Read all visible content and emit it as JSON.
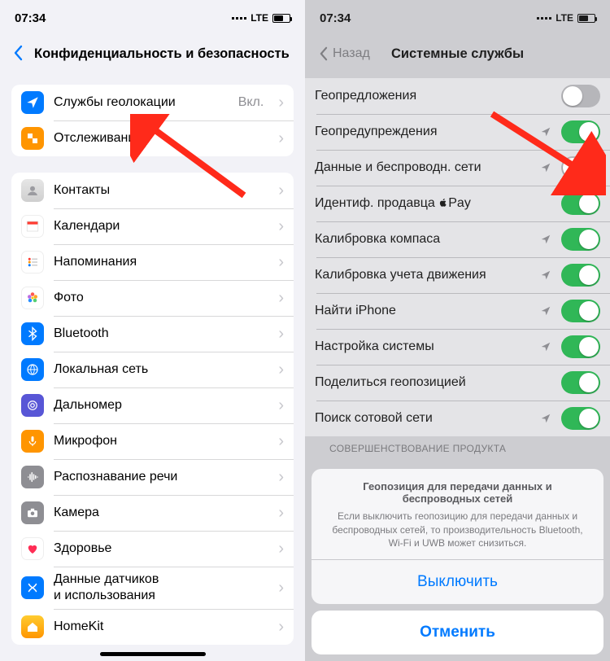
{
  "status": {
    "time": "07:34",
    "network": "LTE"
  },
  "left": {
    "title": "Конфиденциальность и безопасность",
    "group1": [
      {
        "icon": "location",
        "color": "#007aff",
        "label": "Службы геолокации",
        "detail": "Вкл."
      },
      {
        "icon": "tracking",
        "color": "#ff9500",
        "label": "Отслеживание"
      }
    ],
    "group2": [
      {
        "icon": "contacts",
        "color": "#dcdcdc",
        "label": "Контакты"
      },
      {
        "icon": "calendar",
        "color": "#ffffff",
        "label": "Календари"
      },
      {
        "icon": "reminders",
        "color": "#ffffff",
        "label": "Напоминания"
      },
      {
        "icon": "photos",
        "color": "#ffffff",
        "label": "Фото"
      },
      {
        "icon": "bluetooth",
        "color": "#007aff",
        "label": "Bluetooth"
      },
      {
        "icon": "localnet",
        "color": "#007aff",
        "label": "Локальная сеть"
      },
      {
        "icon": "rangefinder",
        "color": "#5856d6",
        "label": "Дальномер"
      },
      {
        "icon": "microphone",
        "color": "#ff9500",
        "label": "Микрофон"
      },
      {
        "icon": "speech",
        "color": "#8e8e93",
        "label": "Распознавание речи"
      },
      {
        "icon": "camera",
        "color": "#8e8e93",
        "label": "Камера"
      },
      {
        "icon": "health",
        "color": "#ffffff",
        "label": "Здоровье"
      },
      {
        "icon": "sensors",
        "color": "#007aff",
        "label": "Данные датчиков и использования"
      },
      {
        "icon": "homekit",
        "color": "#ff9500",
        "label": "HomeKit"
      }
    ]
  },
  "right": {
    "back": "Назад",
    "title": "Системные службы",
    "rows": [
      {
        "label": "Геопредложения",
        "loc": false,
        "on": false
      },
      {
        "label": "Геопредупреждения",
        "loc": true,
        "on": true
      },
      {
        "label": "Данные и беспроводн. сети",
        "loc": true,
        "on": false
      },
      {
        "label": "Идентиф. продавца Pay",
        "loc": false,
        "on": true,
        "applepay": true
      },
      {
        "label": "Калибровка компаса",
        "loc": true,
        "on": true
      },
      {
        "label": "Калибровка учета движения",
        "loc": true,
        "on": true
      },
      {
        "label": "Найти iPhone",
        "loc": true,
        "on": true
      },
      {
        "label": "Настройка системы",
        "loc": true,
        "on": true
      },
      {
        "label": "Поделиться геопозицией",
        "loc": false,
        "on": true
      },
      {
        "label": "Поиск сотовой сети",
        "loc": true,
        "on": true
      }
    ],
    "section_head": "СОВЕРШЕНСТВОВАНИЕ ПРОДУКТА",
    "sheet": {
      "title": "Геопозиция для передачи данных и беспроводных сетей",
      "message": "Если выключить геопозицию для передачи данных и беспроводных сетей, то производительность Bluetooth, Wi-Fi и UWB может снизиться.",
      "action": "Выключить",
      "cancel": "Отменить"
    }
  }
}
